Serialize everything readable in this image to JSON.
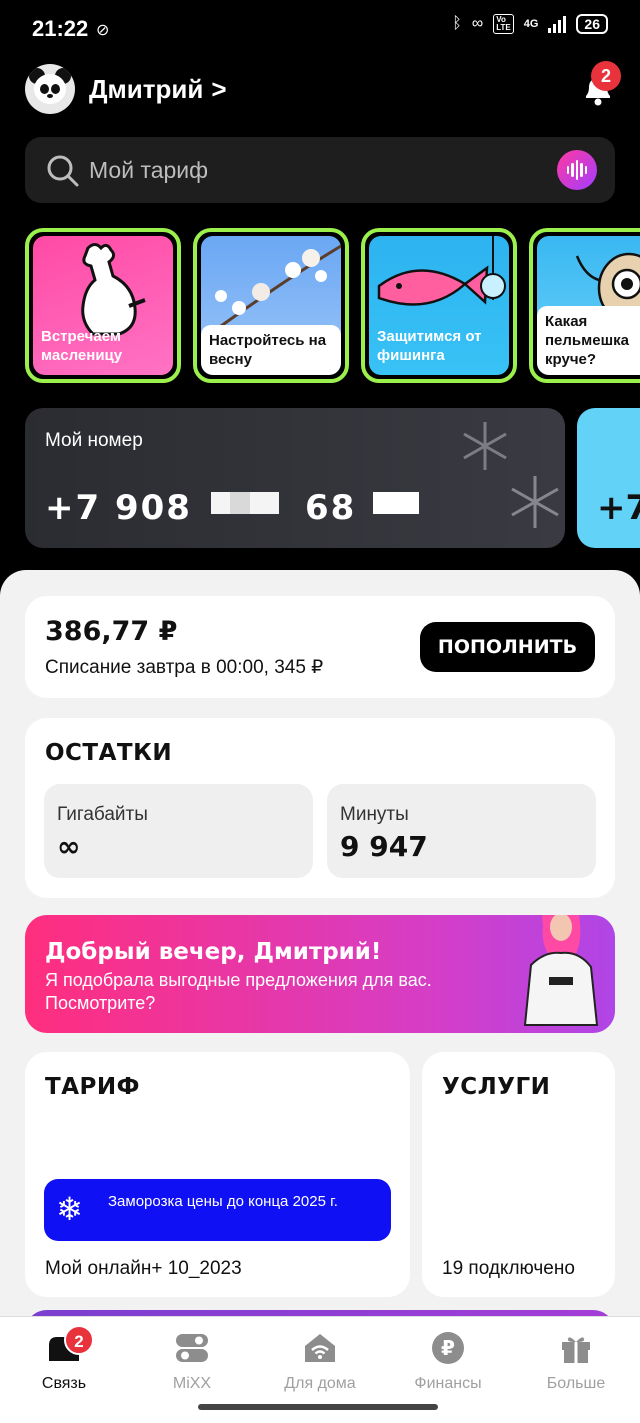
{
  "status_bar": {
    "time": "21:22",
    "battery": "26",
    "network": "4G"
  },
  "profile": {
    "name": "Дмитрий",
    "chevron": ">",
    "notifications_count": "2"
  },
  "search": {
    "placeholder": "Мой тариф"
  },
  "stories": [
    {
      "label": "Встречаем масленицу"
    },
    {
      "label": "Настройтесь на весну"
    },
    {
      "label": "Защитимся от фишинга"
    },
    {
      "label": "Какая пельмешка круче?"
    }
  ],
  "number_card": {
    "title": "Мой номер",
    "number_part1": "+7 908",
    "number_part2": "68",
    "next_card_preview": "+7"
  },
  "balance": {
    "amount": "386,77 ₽",
    "note": "Списание завтра в 00:00, 345 ₽",
    "topup_label": "ПОПОЛНИТЬ"
  },
  "remains": {
    "title": "ОСТАТКИ",
    "gigabytes": {
      "label": "Гигабайты",
      "value": "∞"
    },
    "minutes": {
      "label": "Минуты",
      "value": "9 947"
    }
  },
  "promo": {
    "title": "Добрый вечер, Дмитрий!",
    "text": "Я подобрала выгодные предложения для вас. Посмотрите?"
  },
  "tariff": {
    "title": "ТАРИФ",
    "badge": "Заморозка цены до конца 2025 г.",
    "name": "Мой онлайн+ 10_2023"
  },
  "services": {
    "title": "УСЛУГИ",
    "count": "19 подключено"
  },
  "nav": {
    "items": [
      {
        "label": "Связь",
        "badge": "2"
      },
      {
        "label": "MiXX"
      },
      {
        "label": "Для дома"
      },
      {
        "label": "Финансы"
      },
      {
        "label": "Больше"
      }
    ]
  },
  "colors": {
    "accent_green": "#9cf04c",
    "brand_pink": "#ff2e7e",
    "freeze_blue": "#1010f5",
    "badge_red": "#e8323c"
  }
}
